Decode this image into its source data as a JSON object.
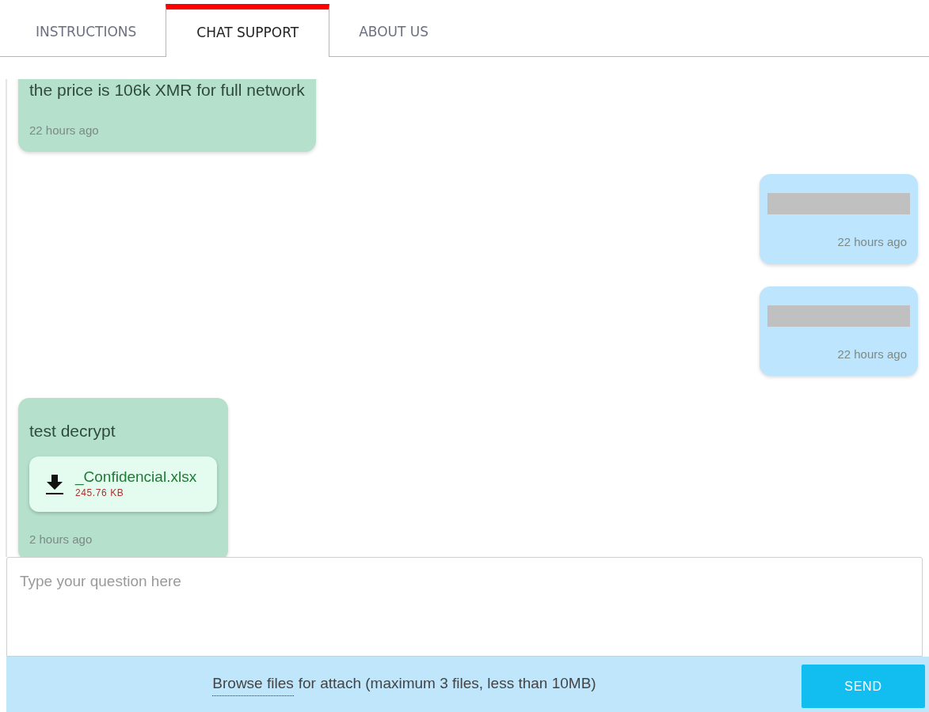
{
  "tabs": [
    {
      "label": "INSTRUCTIONS",
      "selected": false
    },
    {
      "label": "CHAT SUPPORT",
      "selected": true
    },
    {
      "label": "ABOUT US",
      "selected": false
    }
  ],
  "messages": [
    {
      "kind": "received",
      "text": "the price is 106k XMR for full network",
      "time": "22 hours ago"
    },
    {
      "kind": "sent",
      "redacted": true,
      "time": "22 hours ago"
    },
    {
      "kind": "sent",
      "redacted": true,
      "time": "22 hours ago"
    },
    {
      "kind": "received",
      "text": "test decrypt",
      "attachment": {
        "name": "_Confidencial.xlsx",
        "size": "245.76 KB"
      },
      "time": "2 hours ago"
    }
  ],
  "composer": {
    "placeholder": "Type your question here",
    "browse_link": "Browse files",
    "attach_note": "for attach (maximum 3 files, less than 10MB)",
    "send_button": "SEND"
  }
}
